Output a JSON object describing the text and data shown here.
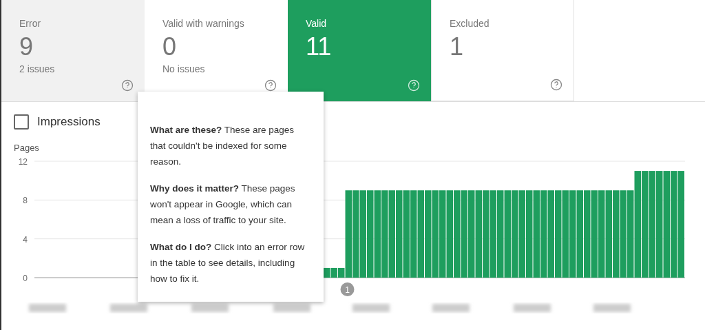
{
  "cards": [
    {
      "title": "Error",
      "count": "9",
      "subtitle": "2 issues",
      "selected": false,
      "kind": "error"
    },
    {
      "title": "Valid with warnings",
      "count": "0",
      "subtitle": "No issues",
      "selected": false,
      "kind": "warning"
    },
    {
      "title": "Valid",
      "count": "11",
      "selected": true,
      "kind": "valid"
    },
    {
      "title": "Excluded",
      "count": "1",
      "selected": false,
      "kind": "excluded"
    }
  ],
  "legend": {
    "label": "Impressions",
    "checked": false
  },
  "chart": {
    "chart_data": {
      "type": "bar",
      "ylabel": "Pages",
      "ylim": [
        0,
        12
      ],
      "yticks": [
        0,
        4,
        8,
        12
      ],
      "values": [
        null,
        null,
        null,
        null,
        null,
        null,
        null,
        null,
        null,
        null,
        null,
        null,
        null,
        null,
        null,
        null,
        null,
        null,
        null,
        null,
        null,
        null,
        null,
        null,
        null,
        null,
        null,
        null,
        null,
        null,
        null,
        null,
        null,
        null,
        null,
        null,
        null,
        null,
        null,
        null,
        1,
        1,
        1,
        9,
        9,
        9,
        9,
        9,
        9,
        9,
        9,
        9,
        9,
        9,
        9,
        9,
        9,
        9,
        9,
        9,
        9,
        9,
        9,
        9,
        9,
        9,
        9,
        9,
        9,
        9,
        9,
        9,
        9,
        9,
        9,
        9,
        9,
        9,
        9,
        9,
        9,
        9,
        9,
        11,
        11,
        11,
        11,
        11,
        11,
        11
      ],
      "annotations": [
        "1"
      ]
    }
  },
  "tooltip": {
    "paragraphs": [
      "**What are these?** These are pages that couldn't be indexed for some reason.",
      "**Why does it matter?** These pages won't appear in Google, which can mean a loss of traffic to your site.",
      "**What do I do?** Click into an error row in the table to see details, including how to fix it."
    ]
  }
}
